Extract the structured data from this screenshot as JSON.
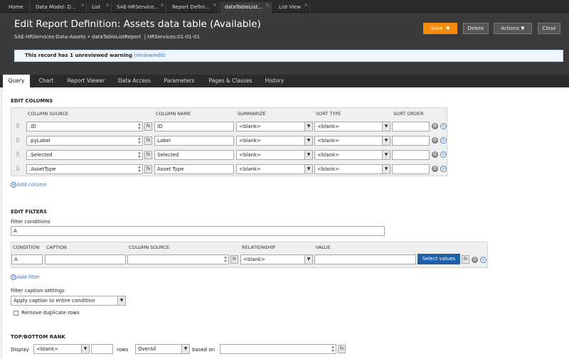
{
  "top_tabs": [
    {
      "label": "Home",
      "closable": false
    },
    {
      "label": "Data Model: D...",
      "closable": true
    },
    {
      "label": "List",
      "closable": true
    },
    {
      "label": "SAE-HRService...",
      "closable": true
    },
    {
      "label": "Report Defini...",
      "closable": true
    },
    {
      "label": "dataTableList...",
      "closable": true,
      "active": true
    },
    {
      "label": "List View",
      "closable": true
    }
  ],
  "header": {
    "title": "Edit  Report Definition:  Assets data table  (Available)",
    "subtitle": "SAE-HRServices-Data-Assets • dataTableListReport",
    "ruleset": "HRServices:01-01-01",
    "buttons": {
      "save": "Save",
      "delete": "Delete",
      "actions": "Actions",
      "close": "Close"
    }
  },
  "warning": {
    "text": "This record has 1 unreviewed warning",
    "link": "(review/edit)"
  },
  "sub_tabs": [
    "Query",
    "Chart",
    "Report Viewer",
    "Data Access",
    "Parameters",
    "Pages & Classes",
    "History"
  ],
  "edit_columns": {
    "section_title": "EDIT COLUMNS",
    "headers": {
      "source": "COLUMN SOURCE",
      "name": "COLUMN NAME",
      "summarize": "SUMMARIZE",
      "sort_type": "SORT TYPE",
      "sort_order": "SORT ORDER"
    },
    "rows": [
      {
        "source": ".ID",
        "name": "ID",
        "summarize": "<blank>",
        "sort_type": "<blank>",
        "sort_order": ""
      },
      {
        "source": ".pyLabel",
        "name": "Label",
        "summarize": "<blank>",
        "sort_type": "<blank>",
        "sort_order": ""
      },
      {
        "source": ".Selected",
        "name": "Selected",
        "summarize": "<blank>",
        "sort_type": "<blank>",
        "sort_order": ""
      },
      {
        "source": ".AssetType",
        "name": "Asset Type",
        "summarize": "<blank>",
        "sort_type": "<blank>",
        "sort_order": ""
      }
    ],
    "add_label": "Add column"
  },
  "edit_filters": {
    "section_title": "EDIT FILTERS",
    "conditions_label": "Filter conditions",
    "conditions_value": "A",
    "headers": {
      "condition": "CONDITION",
      "caption": "CAPTION",
      "source": "COLUMN SOURCE",
      "relationship": "RELATIONSHIP",
      "value": "VALUE"
    },
    "row": {
      "condition": "A",
      "caption": "",
      "source": "",
      "relationship": "<blank>",
      "value": ""
    },
    "select_values": "Select values",
    "add_label": "Add filter",
    "caption_settings_label": "Filter caption settings",
    "caption_settings_value": "Apply caption to entire condition",
    "remove_duplicates": "Remove duplicate rows"
  },
  "top_bottom": {
    "section_title": "TOP/BOTTOM RANK",
    "display_label": "Display",
    "display_value": "<blank>",
    "rows_label": "rows",
    "mode_value": "OverAll",
    "based_on_label": "based on"
  }
}
